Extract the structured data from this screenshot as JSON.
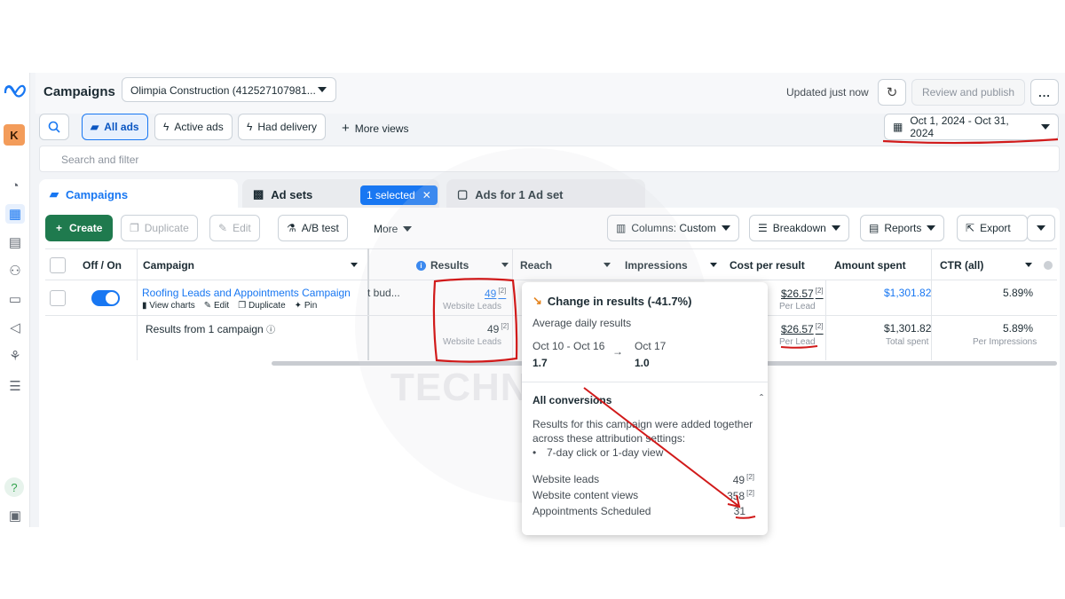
{
  "header": {
    "title": "Campaigns",
    "account": "Olimpia Construction (412527107981...",
    "updated": "Updated just now",
    "review_publish": "Review and publish",
    "more": "..."
  },
  "filters": {
    "all_ads": "All ads",
    "active_ads": "Active ads",
    "had_delivery": "Had delivery",
    "more_views": "More views",
    "date_range": "Oct 1, 2024 - Oct 31, 2024",
    "search_placeholder": "Search and filter"
  },
  "tabs": {
    "campaigns": "Campaigns",
    "ad_sets": "Ad sets",
    "selected": "1 selected",
    "ads": "Ads for 1 Ad set"
  },
  "toolbar": {
    "create": "Create",
    "duplicate": "Duplicate",
    "edit": "Edit",
    "ab_test": "A/B test",
    "more": "More",
    "columns": "Columns: Custom",
    "breakdown": "Breakdown",
    "reports": "Reports",
    "export": "Export"
  },
  "columns": {
    "off_on": "Off / On",
    "campaign": "Campaign",
    "results": "Results",
    "reach": "Reach",
    "impressions": "Impressions",
    "cost_per_result": "Cost per result",
    "amount_spent": "Amount spent",
    "ctr": "CTR (all)"
  },
  "rows": [
    {
      "name": "Roofing Leads and Appointments Campaign",
      "budget": "t bud...",
      "results": "49",
      "results_sub": "Website Leads",
      "cost": "$26.57",
      "cost_sub": "Per Lead",
      "spent": "$1,301.82",
      "ctr": "5.89%",
      "actions": [
        "View charts",
        "Edit",
        "Duplicate",
        "Pin"
      ]
    }
  ],
  "summary": {
    "label": "Results from 1 campaign",
    "results": "49",
    "results_sub": "Website Leads",
    "cost": "$26.57",
    "cost_sub": "Per Lead",
    "spent": "$1,301.82",
    "spent_sub": "Total spent",
    "ctr": "5.89%",
    "ctr_sub": "Per Impressions"
  },
  "popover": {
    "title": "Change in results (-41.7%)",
    "avg_label": "Average daily results",
    "period_a": "Oct 10 - Oct 16",
    "period_b": "Oct 17",
    "value_a": "1.7",
    "value_b": "1.0",
    "section": "All conversions",
    "desc": "Results for this campaign were added together across these attribution settings:",
    "bullet": "7-day click or 1-day view",
    "items": [
      {
        "label": "Website leads",
        "value": "49"
      },
      {
        "label": "Website content views",
        "value": "358"
      },
      {
        "label": "Appointments Scheduled",
        "value": "31"
      }
    ]
  },
  "watermark": "TECHNOVERSE",
  "colors": {
    "accent": "#1877f2",
    "create": "#1f7a4e",
    "annotation": "#d11a1a"
  }
}
